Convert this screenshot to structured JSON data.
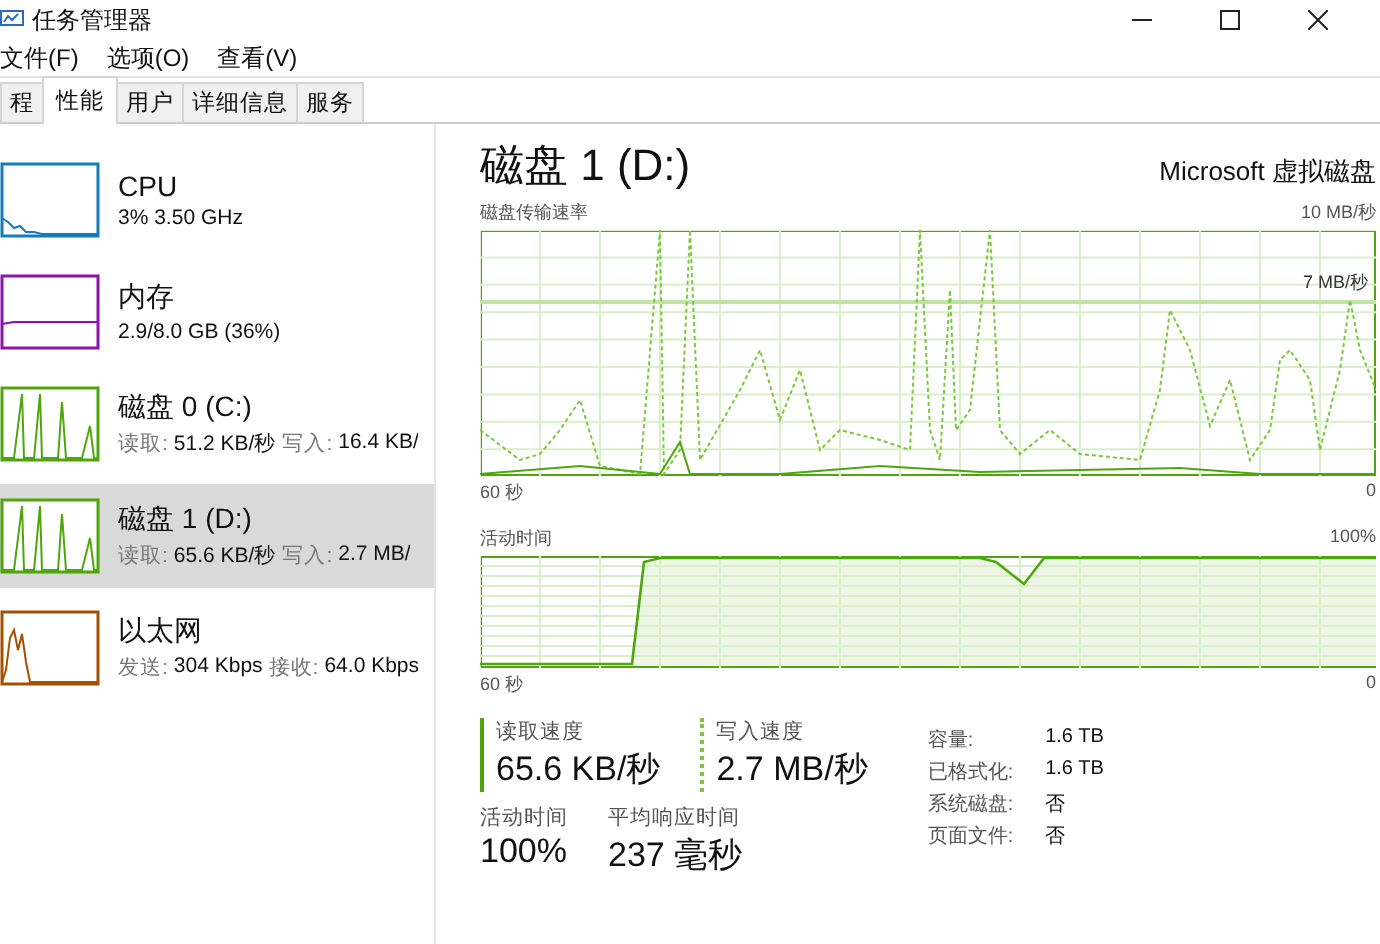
{
  "window": {
    "title": "任务管理器"
  },
  "menu": [
    "文件(F)",
    "选项(O)",
    "查看(V)"
  ],
  "tabs": [
    {
      "label": "程",
      "selected": false
    },
    {
      "label": "性能",
      "selected": true
    },
    {
      "label": "用户",
      "selected": false
    },
    {
      "label": "详细信息",
      "selected": false
    },
    {
      "label": "服务",
      "selected": false
    }
  ],
  "sidebar": {
    "items": [
      {
        "kind": "cpu",
        "name": "CPU",
        "selected": false,
        "detail": [
          {
            "value": "3% 3.50 GHz"
          }
        ]
      },
      {
        "kind": "memory",
        "name": "内存",
        "selected": false,
        "detail": [
          {
            "value": "2.9/8.0 GB (36%)"
          }
        ]
      },
      {
        "kind": "disk",
        "name": "磁盘 0 (C:)",
        "selected": false,
        "detail": [
          {
            "label": "读取:",
            "value": "51.2 KB/秒"
          },
          {
            "label": "写入:",
            "value": "16.4 KB/"
          }
        ]
      },
      {
        "kind": "disk",
        "name": "磁盘 1 (D:)",
        "selected": true,
        "detail": [
          {
            "label": "读取:",
            "value": "65.6 KB/秒"
          },
          {
            "label": "写入:",
            "value": "2.7 MB/"
          }
        ]
      },
      {
        "kind": "ethernet",
        "name": "以太网",
        "selected": false,
        "detail": [
          {
            "label": "发送:",
            "value": "304 Kbps"
          },
          {
            "label": "接收:",
            "value": "64.0 Kbps"
          }
        ]
      }
    ]
  },
  "detail": {
    "title": "磁盘 1 (D:)",
    "model": "Microsoft 虚拟磁盘",
    "transfer_graph": {
      "label": "磁盘传输速率",
      "max": "10 MB/秒",
      "marker": "7 MB/秒",
      "span": "60 秒",
      "min": "0"
    },
    "active_graph": {
      "label": "活动时间",
      "max": "100%",
      "span": "60 秒",
      "min": "0"
    },
    "stats": [
      {
        "kind": "read",
        "label": "读取速度",
        "value": "65.6 KB/秒"
      },
      {
        "kind": "write",
        "label": "写入速度",
        "value": "2.7 MB/秒"
      }
    ],
    "stats2": [
      {
        "label": "活动时间",
        "value": "100%"
      },
      {
        "label": "平均响应时间",
        "value": "237 毫秒"
      }
    ],
    "properties": [
      {
        "label": "容量:",
        "value": "1.6 TB"
      },
      {
        "label": "已格式化:",
        "value": "1.6 TB"
      },
      {
        "label": "系统磁盘:",
        "value": "否"
      },
      {
        "label": "页面文件:",
        "value": "否"
      }
    ]
  }
}
